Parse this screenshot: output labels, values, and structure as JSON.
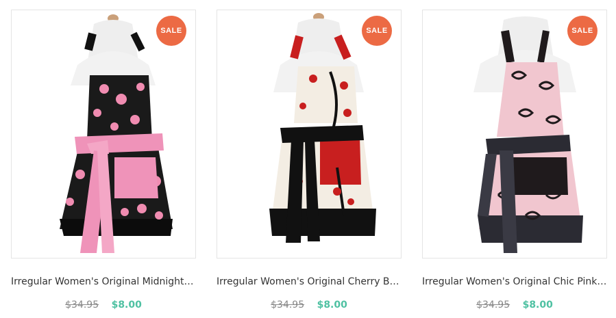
{
  "products": [
    {
      "title": "Irregular Women's Original Midnight Bl...",
      "old_price": "$34.95",
      "new_price": "$8.00",
      "badge": "SALE",
      "image_alt": "midnight-blossom-apron-image",
      "colors": {
        "body": "#1a1a1a",
        "accent": "#f08cb1",
        "sash": "#ef93b9"
      }
    },
    {
      "title": "Irregular Women's Original Cherry Blos...",
      "old_price": "$34.95",
      "new_price": "$8.00",
      "badge": "SALE",
      "image_alt": "cherry-blossom-apron-image",
      "colors": {
        "body": "#f3ede3",
        "accent": "#c81f1f",
        "sash": "#111111"
      }
    },
    {
      "title": "Irregular Women's Original Chic Pink A...",
      "old_price": "$34.95",
      "new_price": "$8.00",
      "badge": "SALE",
      "image_alt": "chic-pink-apron-image",
      "colors": {
        "body": "#f1c6cf",
        "accent": "#1f1a1c",
        "sash": "#2b2b33"
      }
    }
  ],
  "colors": {
    "sale_badge": "#ec6a44",
    "new_price": "#4fc1a2",
    "old_price": "#888888"
  }
}
